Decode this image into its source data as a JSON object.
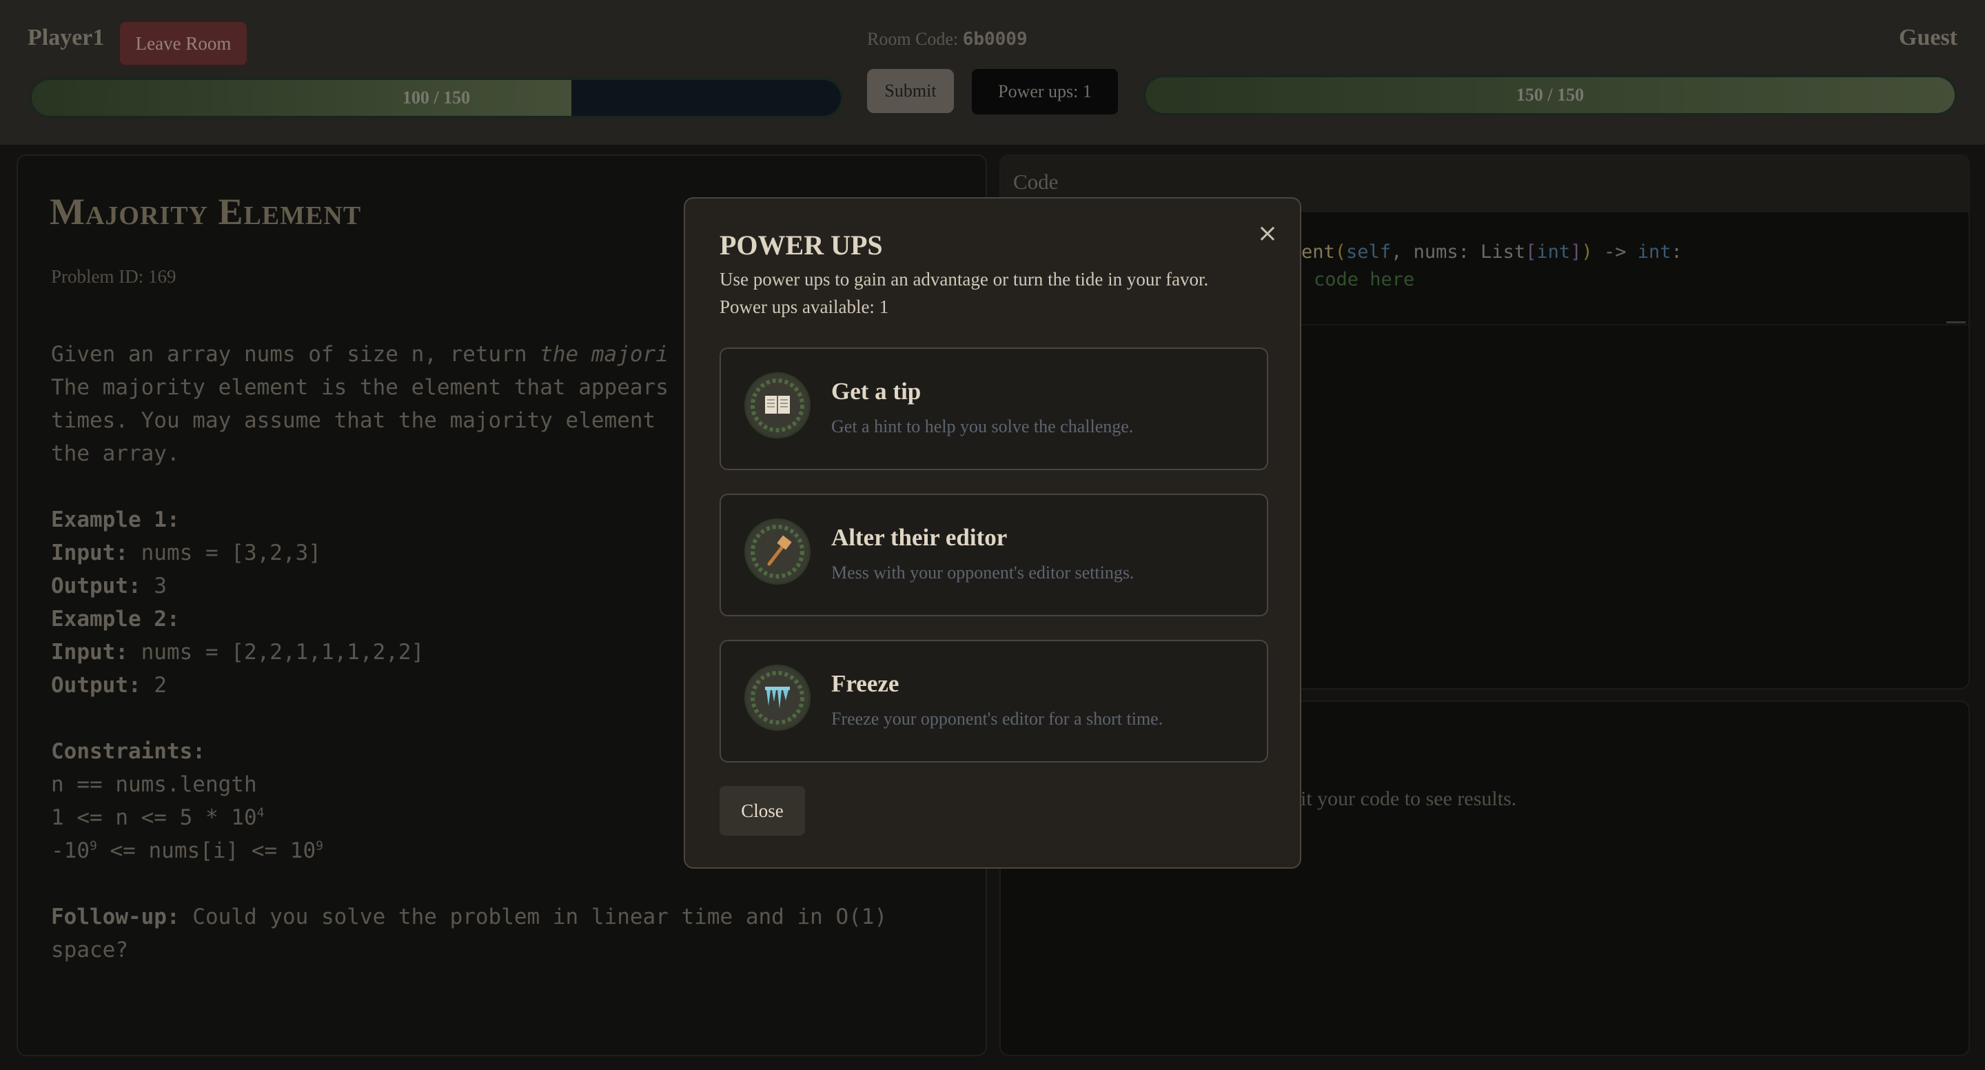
{
  "header": {
    "player1_name": "Player1",
    "leave_label": "Leave Room",
    "room_code_label": "Room Code:",
    "room_code": "6b0009",
    "player2_name": "Guest",
    "player1_hp_text": "100 / 150",
    "player1_hp_fraction": 0.667,
    "player2_hp_text": "150 / 150",
    "player2_hp_fraction": 1.0,
    "submit_label": "Submit",
    "powerups_label": "Power ups: 1"
  },
  "problem": {
    "title": "Majority Element",
    "problem_id": "Problem ID: 169",
    "desc_line1_a": "Given an array nums of size n, return ",
    "desc_line1_b": "the majori",
    "desc_line2": "The majority element is the element that appears",
    "desc_line3": "times. You may assume that the majority element",
    "desc_line4": "the array.",
    "ex1_title": "Example 1:",
    "ex1_input_label": "Input:",
    "ex1_input": " nums = [3,2,3]",
    "ex1_output_label": "Output:",
    "ex1_output": " 3",
    "ex2_title": "Example 2:",
    "ex2_input_label": "Input:",
    "ex2_input": " nums = [2,2,1,1,1,2,2]",
    "ex2_output_label": "Output:",
    "ex2_output": " 2",
    "constraints_title": "Constraints:",
    "c1": "n == nums.length",
    "c2_a": "1 <= n <= 5 * 10",
    "c2_sup": "4",
    "c3_a": "-10",
    "c3_sup1": "9",
    "c3_b": " <= nums[i] <= 10",
    "c3_sup2": "9",
    "followup_label": "Follow-up:",
    "followup_line1": " Could you solve the problem in linear time and in O(1)",
    "followup_line2": "space?"
  },
  "code": {
    "header_label": "Code",
    "line1_a": "ent",
    "line1_b": "(",
    "line1_c": "self",
    "line1_d": ", nums: List",
    "line1_e": "[",
    "line1_f": "int",
    "line1_g": "]",
    "line1_h": ")",
    "line1_i": " -> ",
    "line1_j": "int",
    "line1_k": ":",
    "line2": "code here"
  },
  "results": {
    "text": "nit your code to see results."
  },
  "modal": {
    "title": "POWER UPS",
    "description": "Use power ups to gain an advantage or turn the tide in your favor.",
    "available": "Power ups available: 1",
    "close_label": "Close",
    "close_x": "×",
    "powerups": [
      {
        "name": "Get a tip",
        "desc": "Get a hint to help you solve the challenge.",
        "icon": "book-icon"
      },
      {
        "name": "Alter their editor",
        "desc": "Mess with your opponent's editor settings.",
        "icon": "hammer-icon"
      },
      {
        "name": "Freeze",
        "desc": "Freeze your opponent's editor for a short time.",
        "icon": "icicle-icon"
      }
    ]
  },
  "colors": {
    "background": "#1f1d1a",
    "header": "#3a3630",
    "leave_button": "#7c3a3a",
    "hp_fill": "#6a7a56",
    "code_keyword": "#5a8ab0",
    "code_comment": "#4e7a4a"
  }
}
